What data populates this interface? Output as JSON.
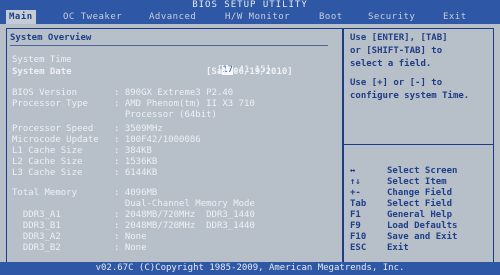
{
  "title": "BIOS SETUP UTILITY",
  "tabs": [
    "Main",
    "OC Tweaker",
    "Advanced",
    "H/W Monitor",
    "Boot",
    "Security",
    "Exit"
  ],
  "section_title": "System Overview",
  "system_time_label": "System Time",
  "system_time_value_cursor": "17",
  "system_time_value_rest": ":41:15]",
  "system_time_open": "[",
  "system_date_label": "System Date",
  "system_date_value": "[Sat 06/19/2010]",
  "info": [
    {
      "label": "BIOS Version",
      "value": ": 890GX Extreme3 P2.40"
    },
    {
      "label": "Processor Type",
      "value": ": AMD Phenom(tm) II X3 710"
    },
    {
      "label": "",
      "value": "  Processor (64bit)"
    },
    {
      "label": "Processor Speed",
      "value": ": 3509MHz"
    },
    {
      "label": "Microcode Update",
      "value": ": 100F42/1000086"
    },
    {
      "label": "L1 Cache Size",
      "value": ": 384KB"
    },
    {
      "label": "L2 Cache Size",
      "value": ": 1536KB"
    },
    {
      "label": "L3 Cache Size",
      "value": ": 6144KB"
    },
    {
      "label": "Total Memory",
      "value": ": 4096MB"
    },
    {
      "label": "",
      "value": "  Dual-Channel Memory Mode"
    },
    {
      "label": "  DDR3_A1",
      "value": ": 2048MB/720MHz  DDR3_1440"
    },
    {
      "label": "  DDR3_B1",
      "value": ": 2048MB/720MHz  DDR3_1440"
    },
    {
      "label": "  DDR3_A2",
      "value": ": None"
    },
    {
      "label": "  DDR3_B2",
      "value": ": None"
    }
  ],
  "help": [
    "Use [ENTER], [TAB]",
    "or [SHIFT-TAB] to",
    "select a field.",
    "",
    "Use [+] or [-] to",
    "configure system Time."
  ],
  "keys": [
    {
      "key": "↔",
      "desc": "Select Screen"
    },
    {
      "key": "↑↓",
      "desc": "Select Item"
    },
    {
      "key": "+-",
      "desc": "Change Field"
    },
    {
      "key": "Tab",
      "desc": "Select Field"
    },
    {
      "key": "F1",
      "desc": "General Help"
    },
    {
      "key": "F9",
      "desc": "Load Defaults"
    },
    {
      "key": "F10",
      "desc": "Save and Exit"
    },
    {
      "key": "ESC",
      "desc": "Exit"
    }
  ],
  "footer": "v02.67C (C)Copyright 1985-2009, American Megatrends, Inc."
}
